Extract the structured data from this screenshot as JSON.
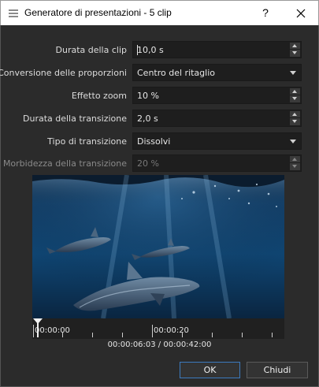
{
  "window": {
    "title": "Generatore di presentazioni - 5 clip",
    "help_label": "?"
  },
  "form": {
    "clip_duration": {
      "label": "Durata della clip",
      "value": "10,0 s"
    },
    "aspect_conversion": {
      "label": "Conversione delle proporzioni",
      "value": "Centro del ritaglio"
    },
    "zoom_effect": {
      "label": "Effetto zoom",
      "value": "10 %"
    },
    "transition_duration": {
      "label": "Durata della transizione",
      "value": "2,0 s"
    },
    "transition_type": {
      "label": "Tipo di transizione",
      "value": "Dissolvi"
    },
    "transition_softness": {
      "label": "Morbidezza della transizione",
      "value": "20 %",
      "disabled": true
    }
  },
  "timeline": {
    "marks": [
      "00:00:00",
      "00:00:20"
    ],
    "timecode": "00:00:06:03 / 00:00:42:00"
  },
  "buttons": {
    "ok": "OK",
    "close": "Chiudi"
  },
  "colors": {
    "background": "#2b2b2b",
    "field": "#1e1e1e",
    "accent": "#3c7bbf"
  }
}
